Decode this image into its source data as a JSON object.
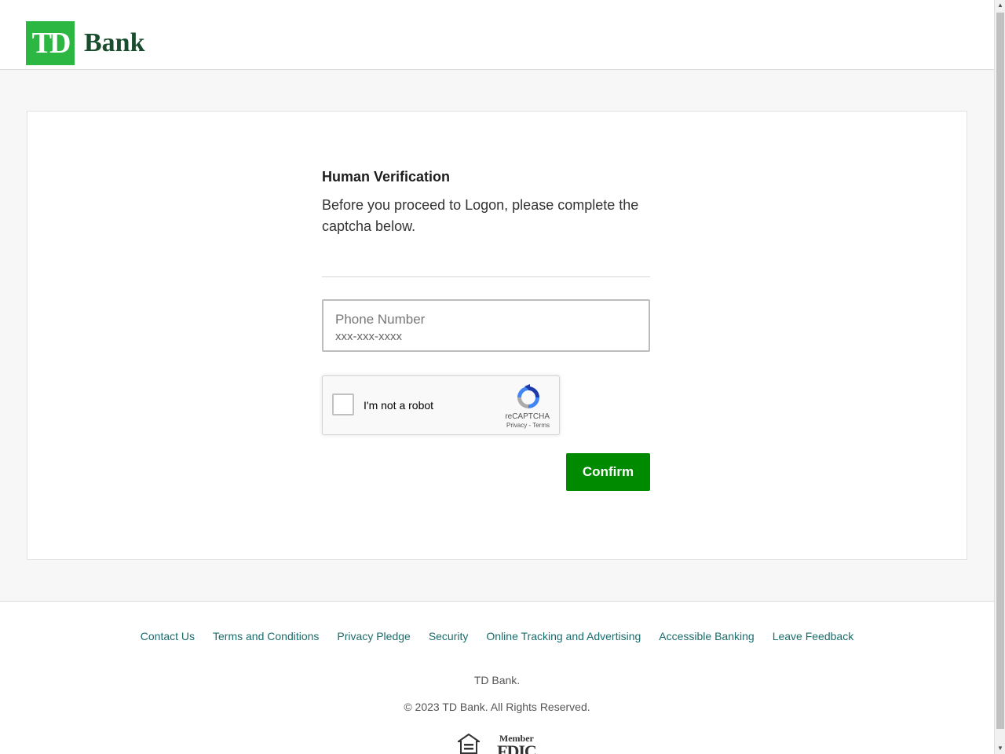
{
  "header": {
    "logo_mark": "TD",
    "logo_text": "Bank"
  },
  "verification": {
    "title": "Human Verification",
    "subtitle": "Before you proceed to Logon, please complete the captcha below.",
    "phone_label": "Phone Number",
    "phone_placeholder": "xxx-xxx-xxxx",
    "phone_value": "",
    "recaptcha_label": "I'm not a robot",
    "recaptcha_brand": "reCAPTCHA",
    "recaptcha_links": "Privacy - Terms",
    "confirm_label": "Confirm"
  },
  "footer": {
    "links": [
      {
        "label": "Contact Us"
      },
      {
        "label": "Terms and Conditions"
      },
      {
        "label": "Privacy Pledge"
      },
      {
        "label": "Security"
      },
      {
        "label": "Online Tracking and Advertising"
      },
      {
        "label": "Accessible Banking"
      },
      {
        "label": "Leave Feedback"
      }
    ],
    "company": "TD Bank.",
    "copyright": "© 2023 TD Bank. All Rights Reserved.",
    "fdic_member": "Member",
    "fdic_main": "FDIC"
  },
  "colors": {
    "brand_green": "#2bb742",
    "confirm_green": "#008a00",
    "link_teal": "#1a6b6b"
  },
  "icons": {
    "recaptcha": "recaptcha-logo-icon",
    "equal_housing": "equal-housing-lender-icon",
    "scroll_up": "chevron-up-icon",
    "scroll_down": "chevron-down-icon"
  }
}
